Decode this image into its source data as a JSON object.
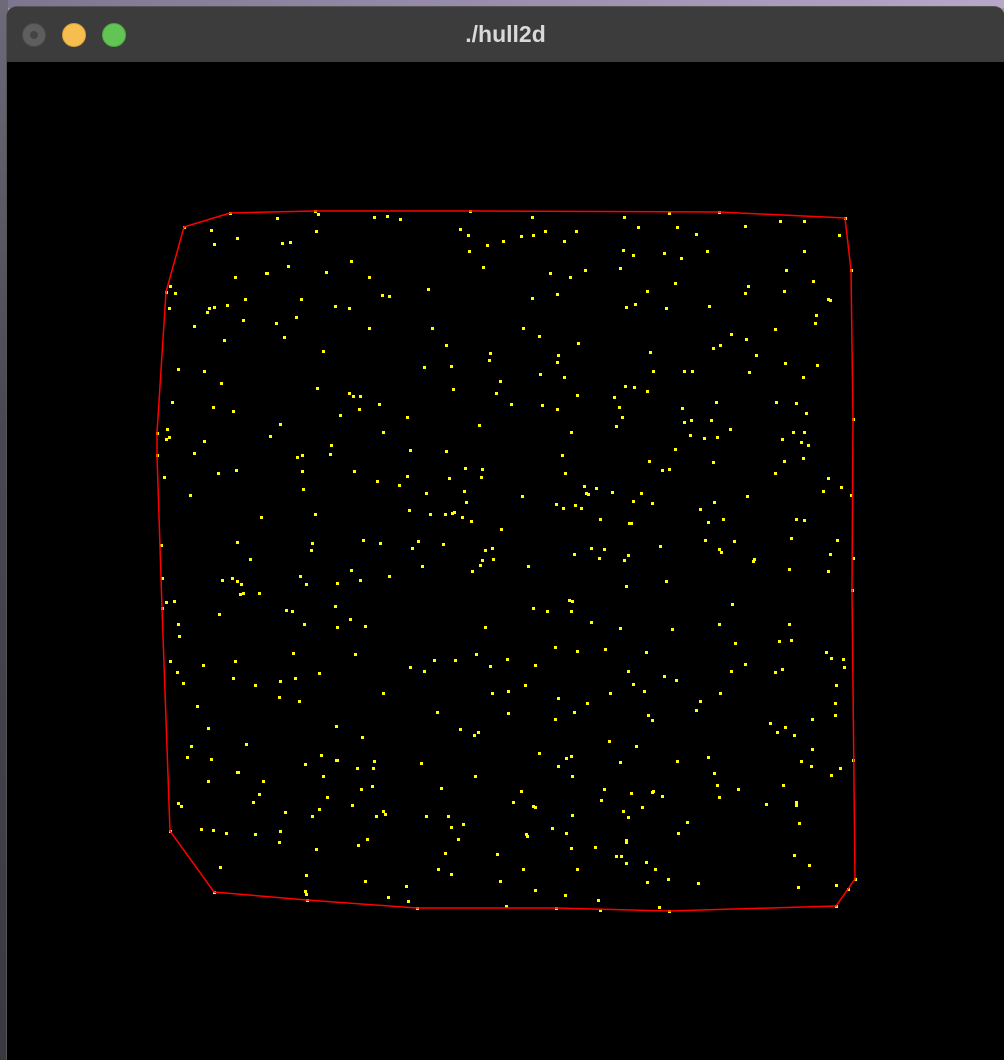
{
  "window": {
    "title": "./hull2d",
    "controls": [
      "close-button",
      "minimize-button",
      "maximize-button"
    ]
  },
  "colors": {
    "background": "#000000",
    "points": "#ffff00",
    "hull": "#ff0000",
    "titlebar": "#3c3c3c",
    "title_text": "#d9d9d9"
  }
}
